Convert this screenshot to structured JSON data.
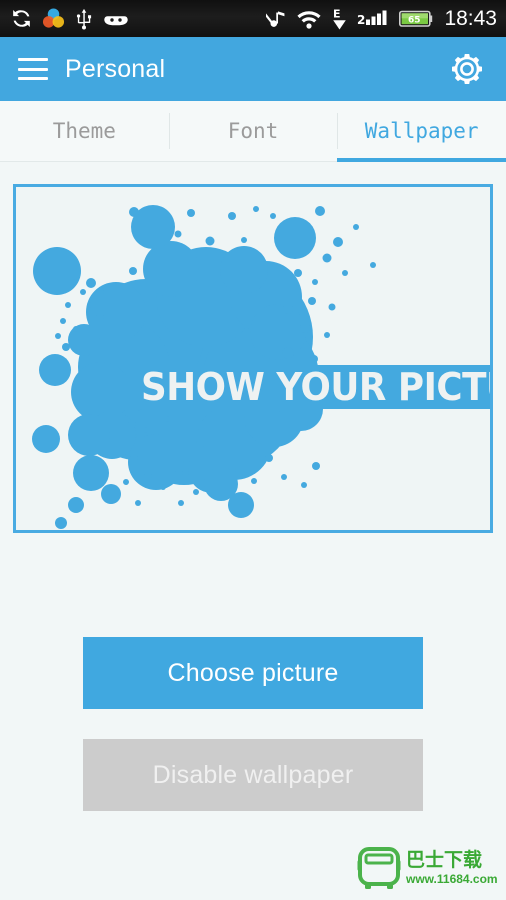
{
  "statusbar": {
    "icons_left": [
      {
        "name": "sync-icon"
      },
      {
        "name": "color-circles-icon"
      },
      {
        "name": "usb-icon"
      },
      {
        "name": "android-head-icon"
      }
    ],
    "icons_right": [
      {
        "name": "music-muted-icon"
      },
      {
        "name": "wifi-icon"
      },
      {
        "name": "edge-network-icon",
        "label": "E"
      },
      {
        "name": "signal-bars-icon",
        "label": "2"
      },
      {
        "name": "battery-icon",
        "label": "65"
      }
    ],
    "clock": "18:43",
    "battery_percent": "65",
    "network_type": "E",
    "sim_label": "2"
  },
  "appbar": {
    "menu_icon": "hamburger-menu-icon",
    "title": "Personal",
    "settings_icon": "gear-icon"
  },
  "tabs": {
    "items": [
      {
        "label": "Theme",
        "active": false
      },
      {
        "label": "Font",
        "active": false
      },
      {
        "label": "Wallpaper",
        "active": true
      }
    ],
    "active_index": 2
  },
  "preview": {
    "name": "wallpaper-preview",
    "banner_text": "SHOW YOUR PICTURE",
    "splatter_color": "#44a9df",
    "background_color": "#eff5f5",
    "border_color": "#49abe2",
    "banner_text_color": "#eef2f2"
  },
  "actions": {
    "choose_picture": "Choose picture",
    "disable_wallpaper": "Disable wallpaper",
    "choose_picture_color": "#40a8e0",
    "disable_wallpaper_color": "#cccccc"
  },
  "watermark": {
    "icon": "bus-logo-icon",
    "brand_cn": "巴士下载",
    "url": "www.11684.com",
    "color": "#3aa935"
  },
  "theme": {
    "accent": "#40a8e0",
    "appbar": "#42a7df",
    "page_bg": "#f2f7f7",
    "statusbar_bg": "#141414"
  }
}
